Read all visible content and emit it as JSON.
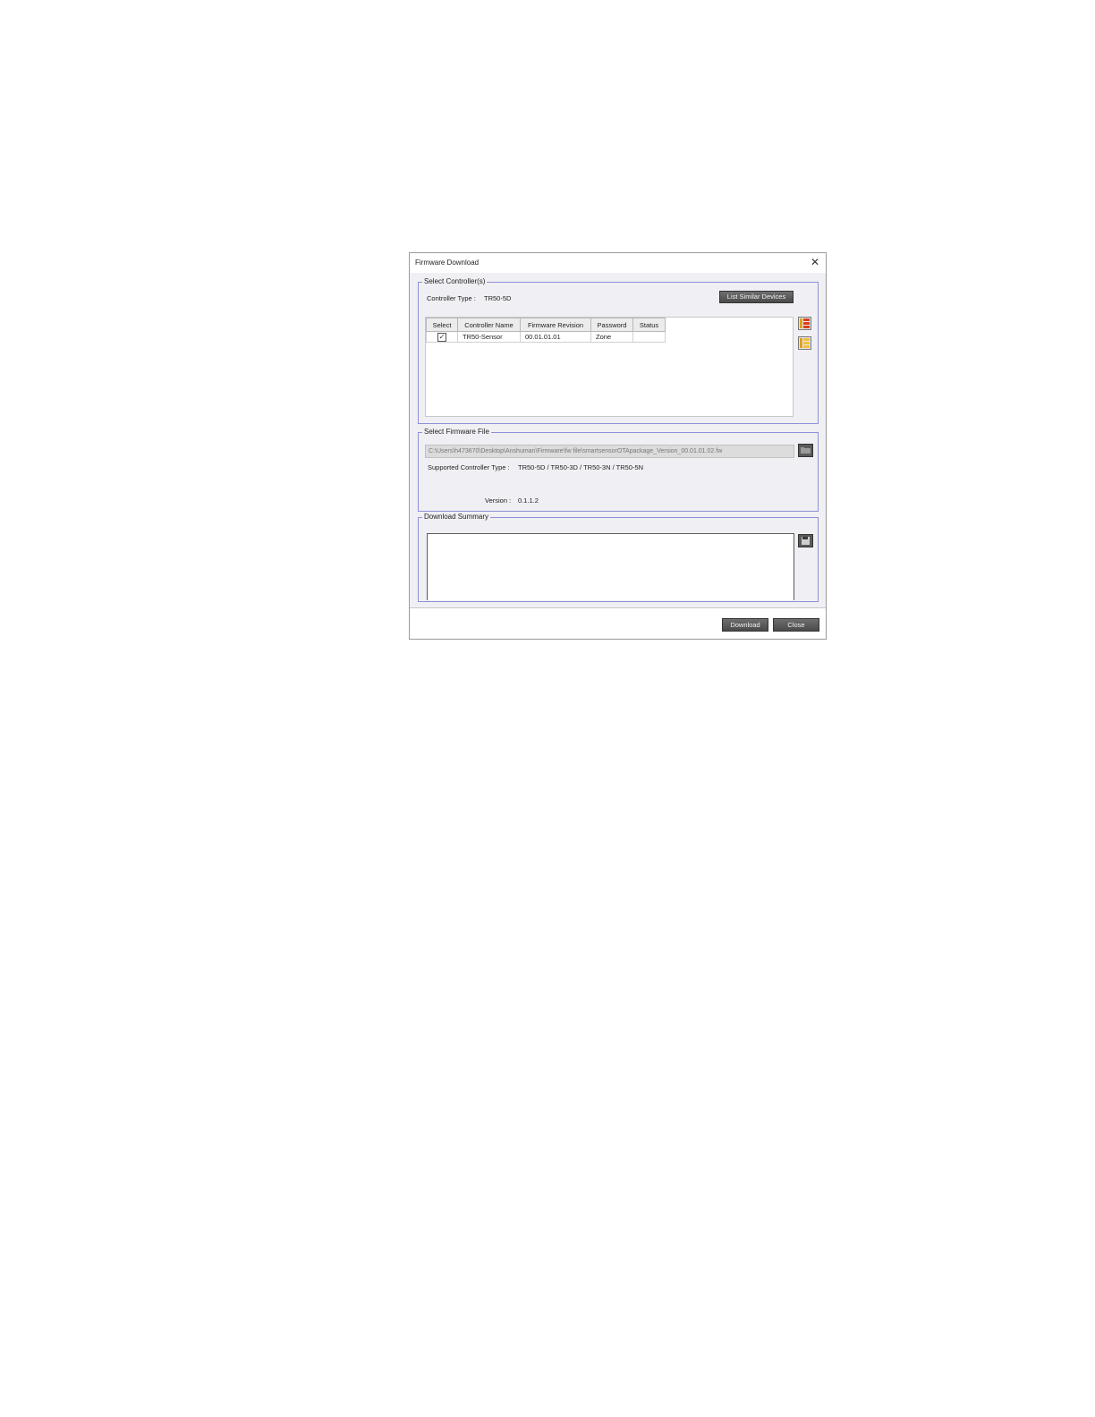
{
  "dialog": {
    "title": "Firmware Download",
    "close_glyph": "✕"
  },
  "select_controllers": {
    "legend": "Select Controller(s)",
    "controller_type_label": "Controller Type :",
    "controller_type_value": "TR50-5D",
    "list_similar_label": "List Similar Devices",
    "columns": [
      "Select",
      "Controller Name",
      "Firmware Revision",
      "Password",
      "Status"
    ],
    "rows": [
      {
        "selected": true,
        "name": "TR50-Sensor",
        "firmware": "00.01.01.01",
        "password": "Zone",
        "status": ""
      }
    ],
    "select_all_icon": "select-all-icon",
    "deselect_all_icon": "deselect-all-icon"
  },
  "select_firmware": {
    "legend": "Select Firmware File",
    "file_path": "C:\\Users\\h473670\\Desktop\\Anshuman\\Firmware\\fw file\\smartsensorOTApackage_Version_00.01.01.02.fw",
    "supported_label": "Supported Controller Type :",
    "supported_value": "TR50-5D / TR50-3D / TR50-3N / TR50-5N",
    "version_label": "Version :",
    "version_value": "0.1.1.2",
    "browse_icon": "browse-folder-icon"
  },
  "download_summary": {
    "legend": "Download Summary",
    "content": "",
    "save_icon": "save-icon"
  },
  "footer": {
    "download_label": "Download",
    "close_label": "Close"
  },
  "colors": {
    "group_border": "#8f8fd8",
    "button_dark": "#555555",
    "client_bg": "#f0f0f4"
  }
}
